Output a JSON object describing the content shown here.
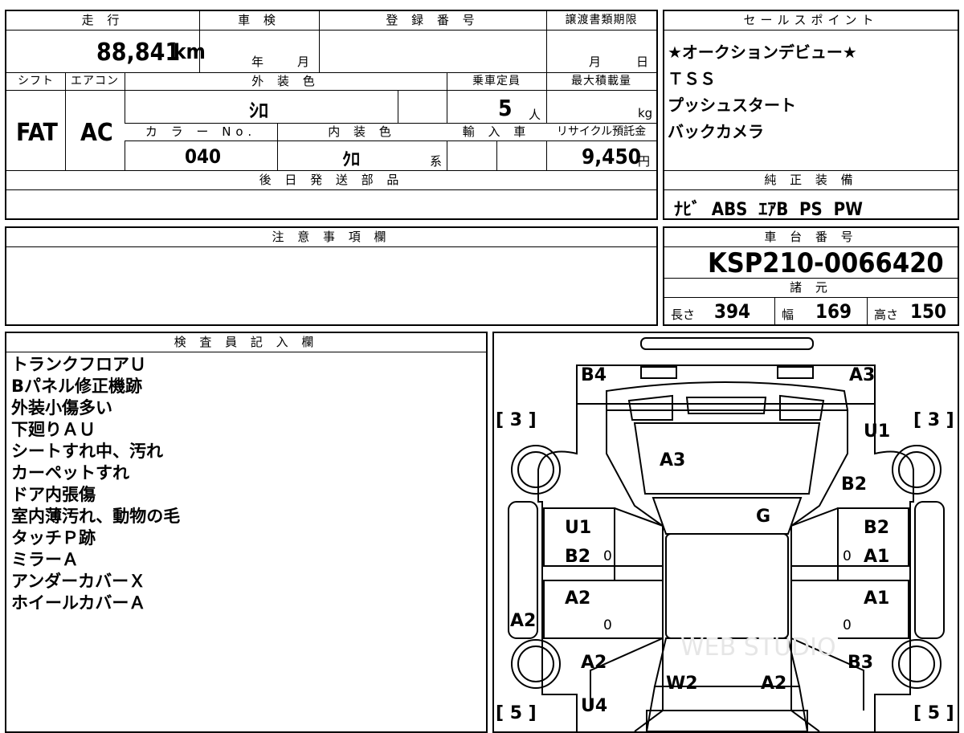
{
  "summary": {
    "mileage_header": "走 行",
    "mileage_value": "88,841",
    "mileage_unit": "km",
    "inspection_header": "車 検",
    "inspection_year_unit": "年",
    "inspection_month_unit": "月",
    "registration_header": "登 録 番 号",
    "transfer_header": "譲渡書類期限",
    "transfer_month_unit": "月",
    "transfer_day_unit": "日",
    "shift_header": "シフト",
    "shift_value": "FAT",
    "ac_header": "エアコン",
    "ac_value": "AC",
    "exterior_header": "外 装 色",
    "exterior_value": "ｼﾛ",
    "capacity_header": "乗車定員",
    "capacity_value": "5",
    "capacity_unit": "人",
    "load_header": "最大積載量",
    "load_unit": "kg",
    "color_no_header": "カ ラ ー No.",
    "color_no_value": "040",
    "interior_header": "内 装 色",
    "interior_value": "ｸﾛ",
    "interior_unit": "系",
    "import_header": "輸 入 車",
    "recycle_header": "リサイクル預託金",
    "recycle_value": "9,450",
    "recycle_unit": "円",
    "later_parts_header": "後 日 発 送 部 品"
  },
  "sales_points": {
    "header": "セールスポイント",
    "lines": [
      "★オークションデビュー★",
      "ＴＳＳ",
      "プッシュスタート",
      "バックカメラ"
    ]
  },
  "equipment": {
    "header": "純 正 装 備",
    "value": "ﾅﾋﾞ  ABS  ｴｱB  PS  PW"
  },
  "notes": {
    "header": "注 意 事 項 欄"
  },
  "chassis": {
    "header": "車 台 番 号",
    "value": "KSP210-0066420",
    "specs_header": "諸 元",
    "length_label": "長さ",
    "length_value": "394",
    "width_label": "幅",
    "width_value": "169",
    "height_label": "高さ",
    "height_value": "150"
  },
  "inspector": {
    "header": "検 査 員 記 入 欄",
    "lines": [
      "トランクフロアＵ",
      "Bパネル修正機跡",
      "外装小傷多い",
      "下廻りＡＵ",
      "シートすれ中、汚れ",
      "カーペットすれ",
      "ドア内張傷",
      "室内薄汚れ、動物の毛",
      "タッチＰ跡",
      "ミラーＡ",
      "アンダーカバーＸ",
      "ホイールカバーＡ"
    ]
  },
  "diagram": {
    "tire_front_left": "[ 3 ]",
    "tire_front_right": "[ 3 ]",
    "tire_rear_left": "[ 5 ]",
    "tire_rear_right": "[ 5 ]",
    "marks": {
      "b4": "B4",
      "a3_top": "A3",
      "u1_right": "U1",
      "a3_hood": "A3",
      "b2_right_fender": "B2",
      "g": "G",
      "u1_left_door": "U1",
      "b2_left_door": "B2",
      "b2_right_door": "B2",
      "a1_right_door": "A1",
      "a2_left_rear_door": "A2",
      "a1_right_rear_door": "A1",
      "a2_left_side": "A2",
      "a2_left_quarter": "A2",
      "b3_right": "B3",
      "w2": "W2",
      "a2_rear": "A2",
      "u4": "U4",
      "zero1": "0",
      "zero2": "0",
      "zero3": "0",
      "zero4": "0"
    },
    "watermark": "WEB STUDIO"
  }
}
